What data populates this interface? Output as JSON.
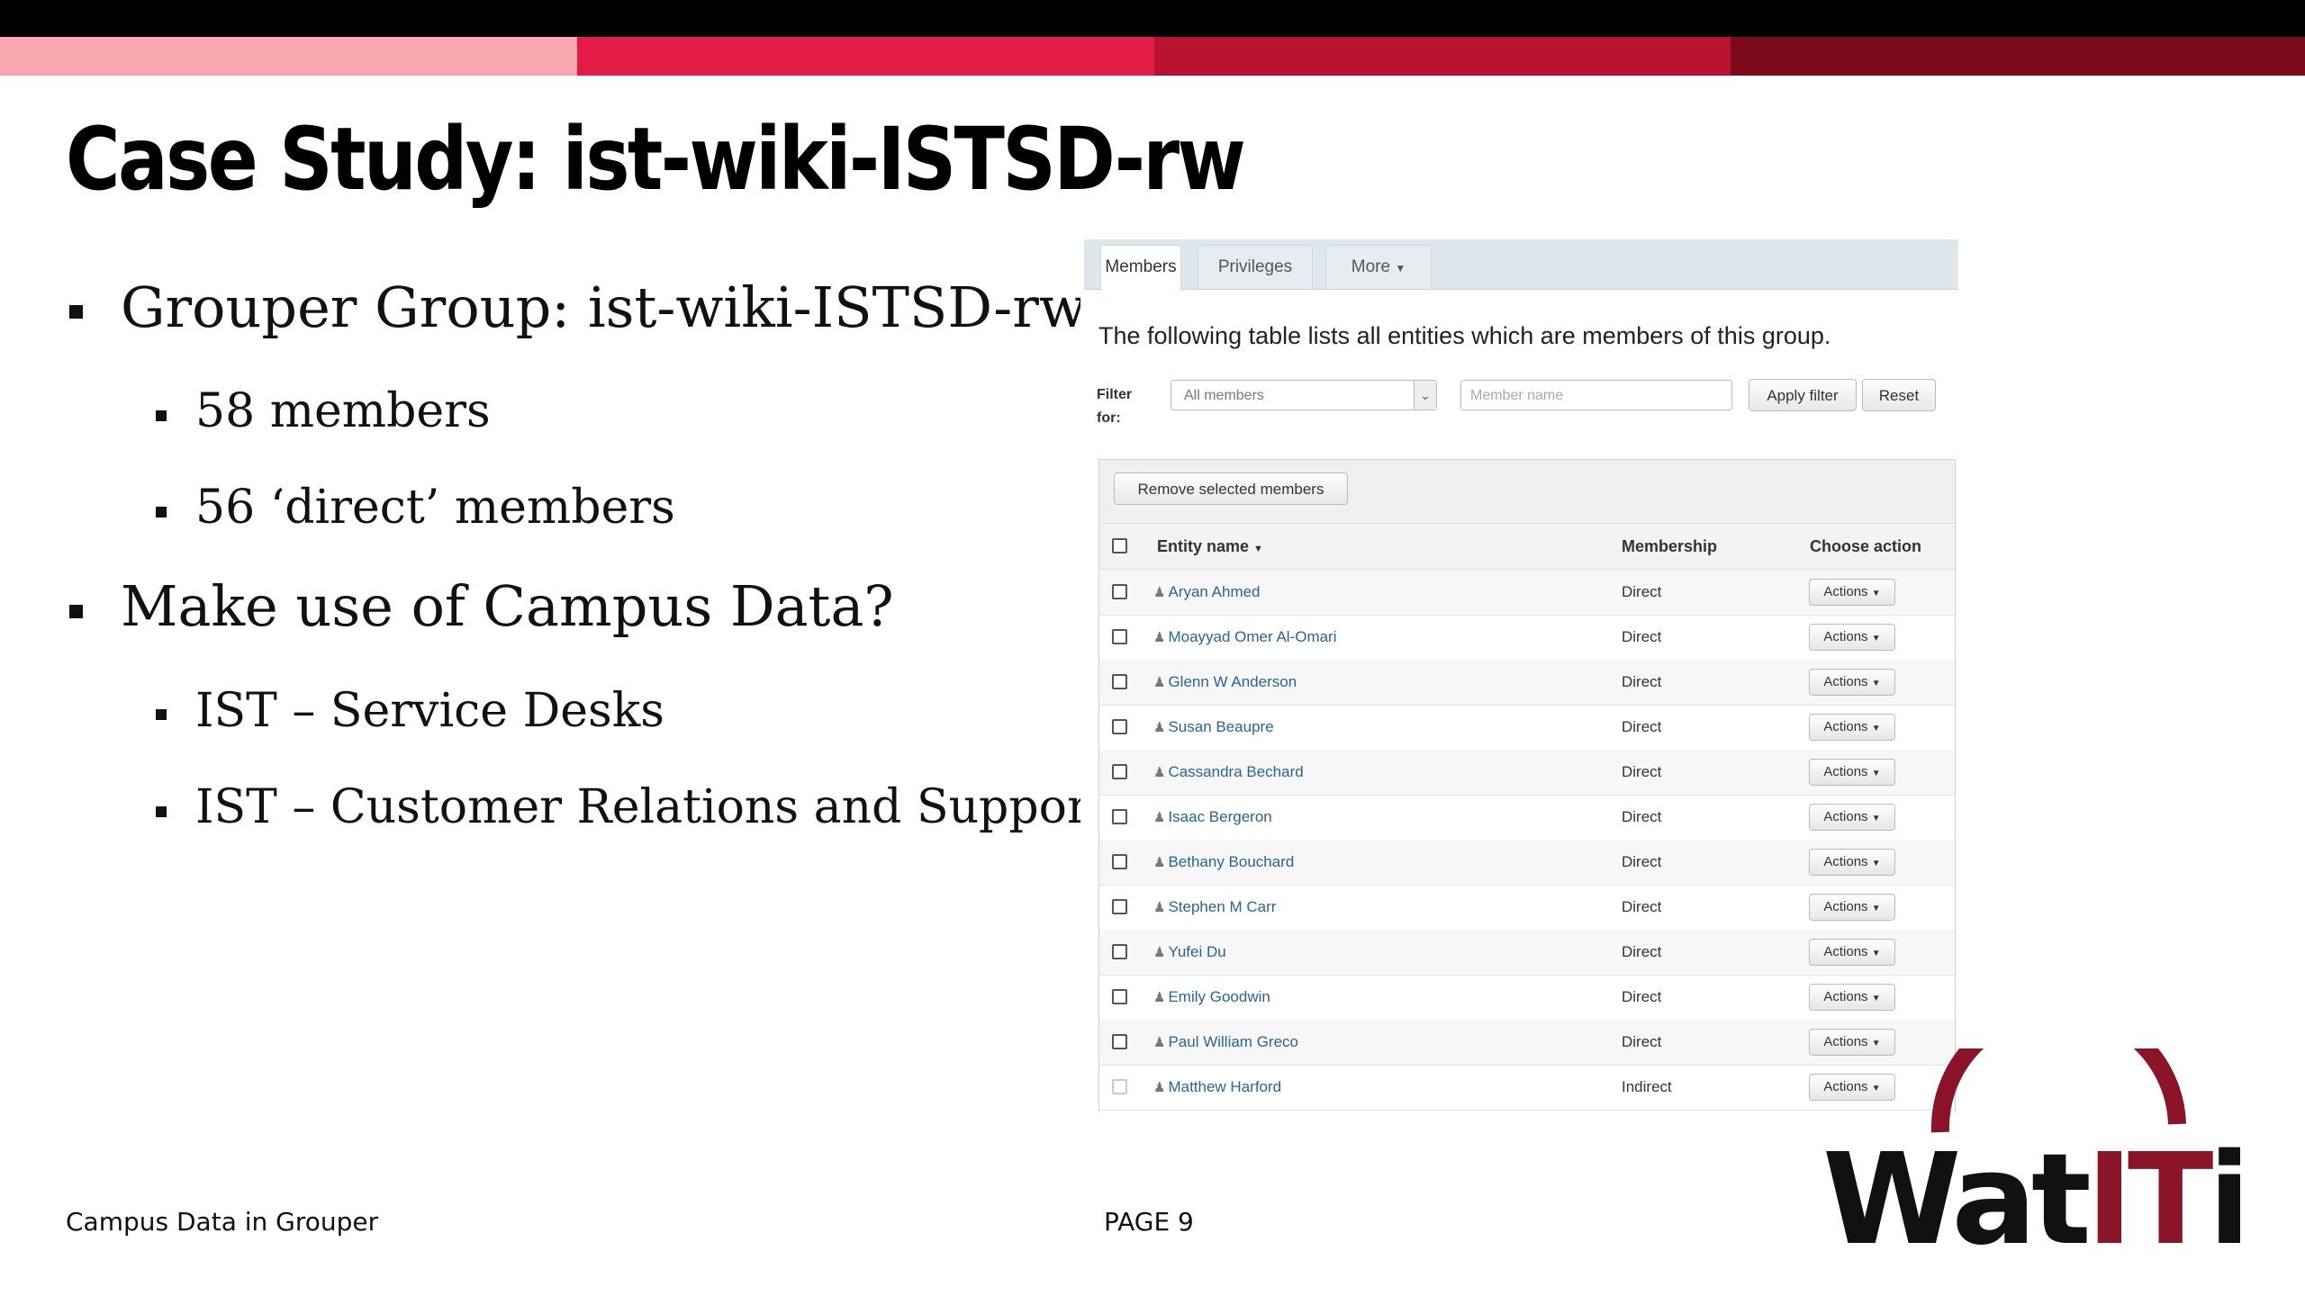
{
  "slide": {
    "title": "Case Study: ist-wiki-ISTSD-rw",
    "bullets": [
      {
        "level": 1,
        "text": "Grouper Group: ist-wiki-ISTSD-rw"
      },
      {
        "level": 2,
        "text": "58 members"
      },
      {
        "level": 2,
        "text": "56 ‘direct’ members"
      },
      {
        "level": 1,
        "text": "Make use of Campus Data?"
      },
      {
        "level": 2,
        "text": "IST – Service Desks"
      },
      {
        "level": 2,
        "text": "IST – Customer Relations and Support"
      }
    ],
    "footer_left": "Campus Data in Grouper",
    "page_label": "PAGE  9",
    "logo_text": "WatITis",
    "colors": {
      "stripe_1": "#f7a7ad",
      "stripe_2": "#e31b47",
      "stripe_3": "#b8122e",
      "stripe_4": "#7c0a1a",
      "logo_red": "#8c1428"
    }
  },
  "grouper": {
    "tabs": [
      "Members",
      "Privileges",
      "More"
    ],
    "active_tab": "Members",
    "intro": "The following table lists all entities which are members of this group.",
    "filter": {
      "label_line1": "Filter",
      "label_line2": "for:",
      "select_value": "All members",
      "input_placeholder": "Member name",
      "apply_label": "Apply filter",
      "reset_label": "Reset"
    },
    "remove_label": "Remove selected members",
    "columns": {
      "entity": "Entity name",
      "membership": "Membership",
      "action": "Choose action"
    },
    "action_label": "Actions",
    "rows": [
      {
        "name": "Aryan Ahmed",
        "membership": "Direct"
      },
      {
        "name": "Moayyad Omer Al-Omari",
        "membership": "Direct"
      },
      {
        "name": "Glenn W Anderson",
        "membership": "Direct"
      },
      {
        "name": "Susan Beaupre",
        "membership": "Direct"
      },
      {
        "name": "Cassandra Bechard",
        "membership": "Direct"
      },
      {
        "name": "Isaac Bergeron",
        "membership": "Direct"
      },
      {
        "name": "Bethany Bouchard",
        "membership": "Direct"
      },
      {
        "name": "Stephen M Carr",
        "membership": "Direct"
      },
      {
        "name": "Yufei Du",
        "membership": "Direct"
      },
      {
        "name": "Emily Goodwin",
        "membership": "Direct"
      },
      {
        "name": "Paul William Greco",
        "membership": "Direct"
      },
      {
        "name": "Matthew Harford",
        "membership": "Indirect"
      }
    ]
  }
}
